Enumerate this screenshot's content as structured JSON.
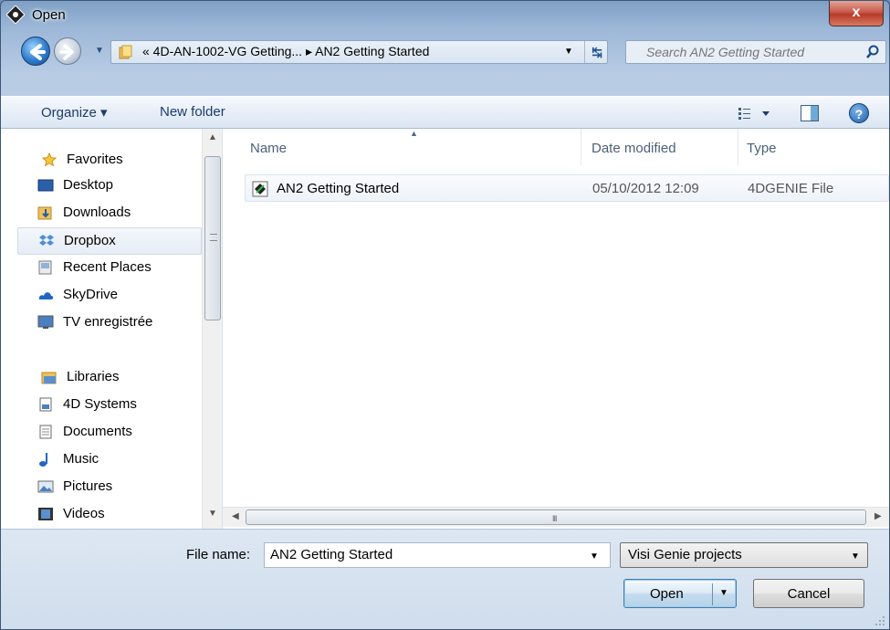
{
  "window": {
    "title": "Open",
    "close_label": "x"
  },
  "navigation": {
    "address_path": "« 4D-AN-1002-VG Getting... ▸ AN2 Getting Started",
    "search_placeholder": "Search AN2 Getting Started"
  },
  "toolbar": {
    "organize_label": "Organize ▾",
    "new_folder_label": "New folder",
    "help_label": "?"
  },
  "nav_pane": {
    "favorites_label": "Favorites",
    "favorites": [
      {
        "label": "Desktop",
        "icon": "desktop-icon"
      },
      {
        "label": "Downloads",
        "icon": "downloads-icon"
      },
      {
        "label": "Dropbox",
        "icon": "dropbox-icon",
        "selected": true
      },
      {
        "label": "Recent Places",
        "icon": "recent-places-icon"
      },
      {
        "label": "SkyDrive",
        "icon": "skydrive-icon"
      },
      {
        "label": "TV enregistrée",
        "icon": "tv-icon"
      }
    ],
    "libraries_label": "Libraries",
    "libraries": [
      {
        "label": "4D Systems",
        "icon": "library-icon"
      },
      {
        "label": "Documents",
        "icon": "documents-icon"
      },
      {
        "label": "Music",
        "icon": "music-icon"
      },
      {
        "label": "Pictures",
        "icon": "pictures-icon"
      },
      {
        "label": "Videos",
        "icon": "videos-icon"
      }
    ]
  },
  "file_list": {
    "columns": [
      "Name",
      "Date modified",
      "Type"
    ],
    "rows": [
      {
        "name": "AN2 Getting Started",
        "date_modified": "05/10/2012 12:09",
        "type": "4DGENIE File"
      }
    ],
    "scroll_grip": "III"
  },
  "footer": {
    "file_name_label": "File name:",
    "file_name_value": "AN2 Getting Started",
    "file_type_value": "Visi Genie projects",
    "open_label": "Open",
    "cancel_label": "Cancel"
  },
  "colors": {
    "accent": "#3c7fb1",
    "close": "#c8594b",
    "link": "#1e3b6a"
  }
}
